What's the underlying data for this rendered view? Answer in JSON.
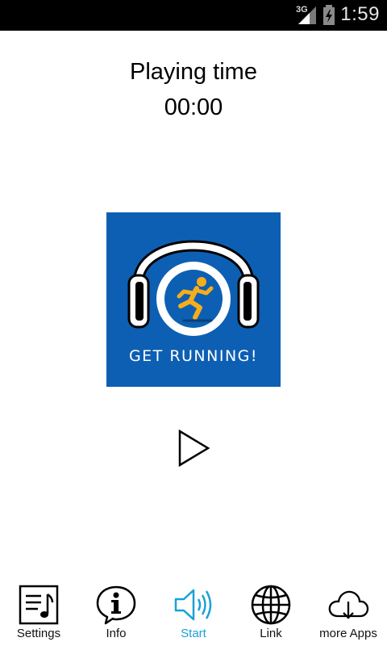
{
  "status_bar": {
    "network": "3G",
    "time": "1:59"
  },
  "player": {
    "label": "Playing time",
    "value": "00:00",
    "cover_caption": "GET RUNNING!"
  },
  "bottom_nav": {
    "active_color": "#1aa0d8",
    "items": [
      {
        "label": "Settings",
        "icon": "music-list-icon"
      },
      {
        "label": "Info",
        "icon": "info-icon"
      },
      {
        "label": "Start",
        "icon": "speaker-icon"
      },
      {
        "label": "Link",
        "icon": "globe-icon"
      },
      {
        "label": "more Apps",
        "icon": "cloud-download-icon"
      }
    ]
  }
}
